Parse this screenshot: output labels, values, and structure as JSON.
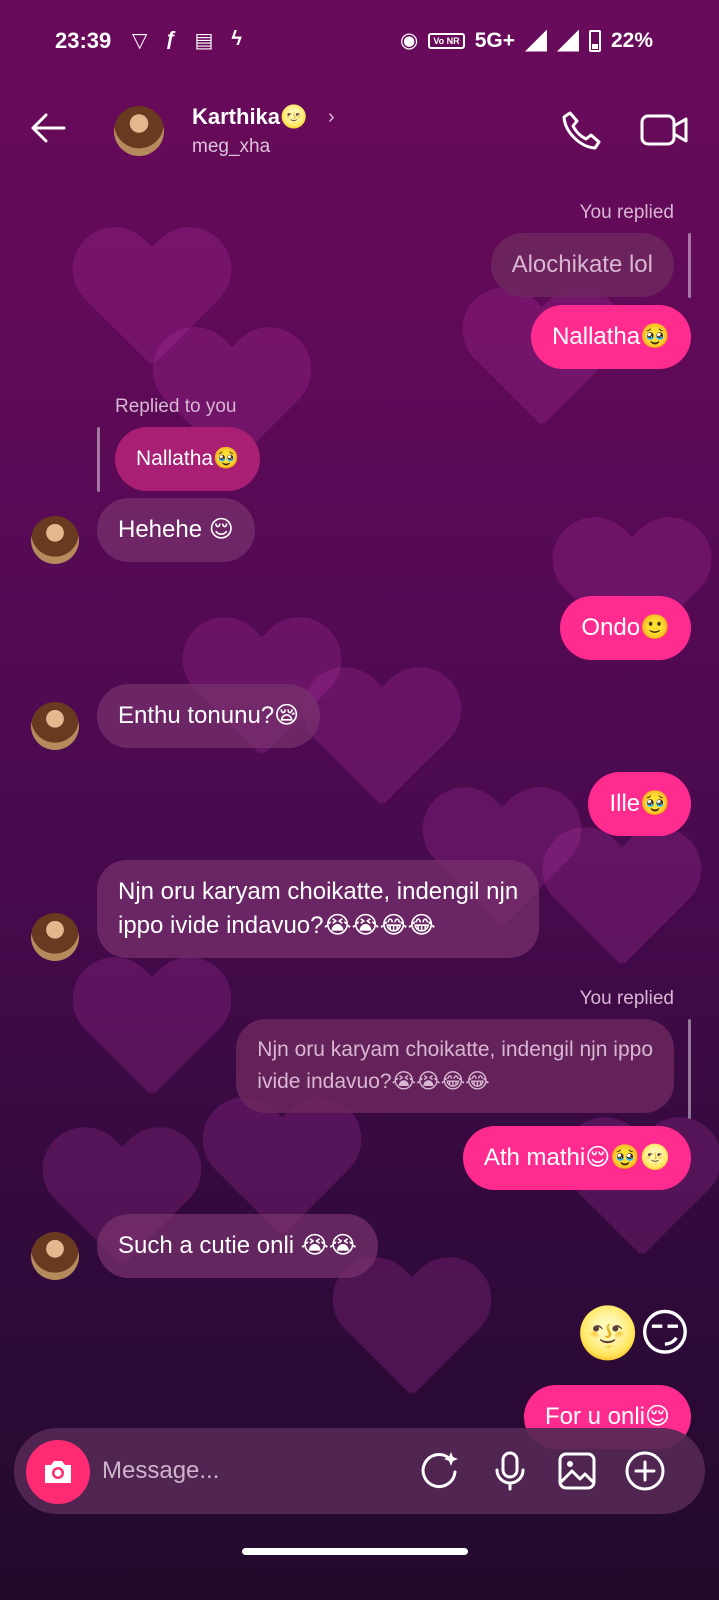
{
  "status_bar": {
    "time": "23:39",
    "network": "5G+",
    "volte": "Vo NR",
    "battery": "22%"
  },
  "header": {
    "contact_name": "Karthika🌝",
    "username": "meg_xha",
    "back_icon": "arrow-left-icon",
    "call_icon": "phone-icon",
    "video_icon": "video-camera-icon"
  },
  "messages": {
    "you_replied_1": "You replied",
    "quote_1": "Alochikate lol",
    "m1": "Nallatha🥹",
    "replied_to_you": "Replied to you",
    "quote_2": "Nallatha🥹",
    "m2": "Hehehe 😌",
    "m3": "Ondo🙂",
    "m4": "Enthu tonunu?😪",
    "m5": "Ille🥹",
    "m6": "Njn oru karyam choikatte, indengil njn\nippo ivide indavuo?😭😭😂😂",
    "you_replied_2": "You replied",
    "quote_3": "Njn oru karyam choikatte, indengil njn ippo\nivide indavuo?😭😭😂😂",
    "m7": "Ath mathi😌🥹🌝",
    "m8": "Such a cutie onli 😭😭",
    "m9": "🌝😏",
    "m10": "For u onli😌"
  },
  "composer": {
    "placeholder": "Message...",
    "camera_icon": "camera-icon",
    "sticker_icon": "sparkle-sticker-icon",
    "mic_icon": "microphone-icon",
    "gallery_icon": "image-gallery-icon",
    "add_icon": "plus-circle-icon"
  },
  "colors": {
    "outgoing_bubble": "#ff2b8f",
    "incoming_bubble": "#7a3270",
    "camera_button": "#ff2b72"
  }
}
